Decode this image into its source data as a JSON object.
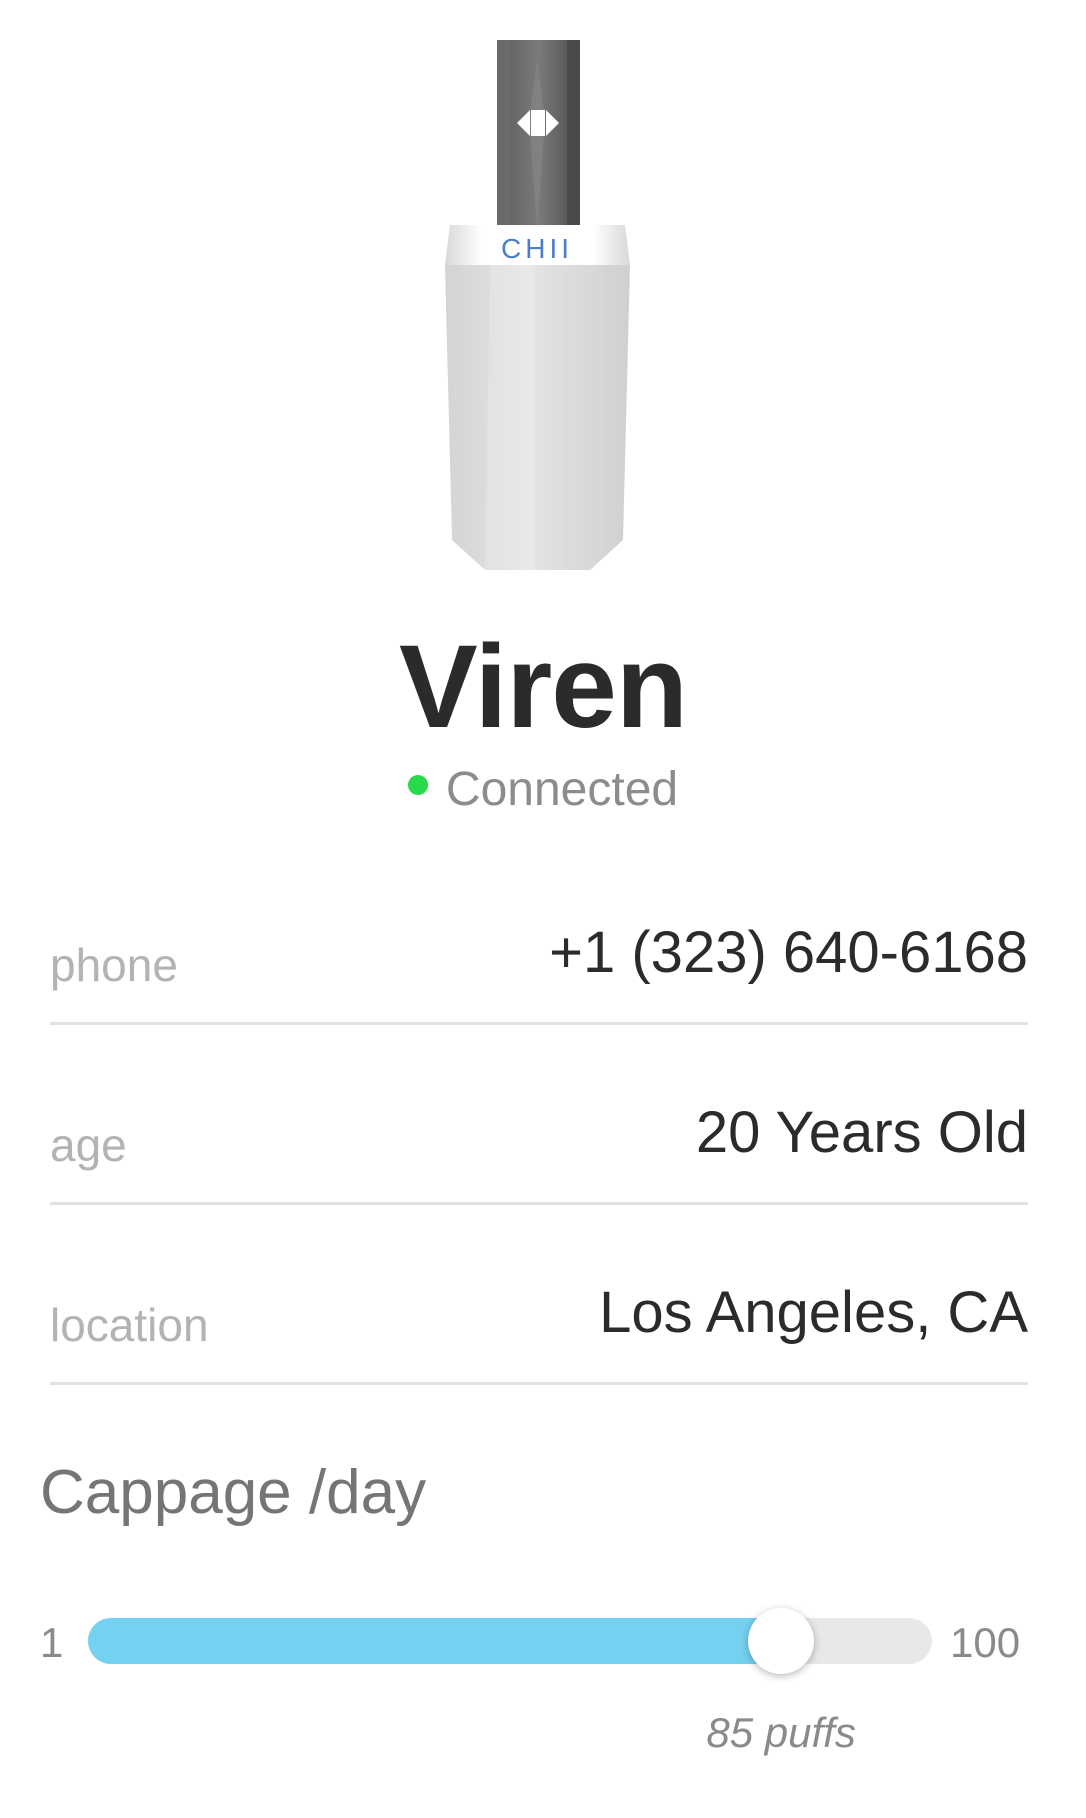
{
  "device": {
    "image_icon": "vape-pod-device-icon",
    "brand_mark": "CHII",
    "name": "Viren",
    "status": "Connected",
    "status_color": "#2ad94a"
  },
  "info": {
    "phone": {
      "label": "phone",
      "value": "+1 (323) 640-6168"
    },
    "age": {
      "label": "age",
      "value": "20 Years Old"
    },
    "location": {
      "label": "location",
      "value": "Los Angeles, CA"
    }
  },
  "cappage": {
    "title": "Cappage /day",
    "min_label": "1",
    "max_label": "100",
    "min": 1,
    "max": 100,
    "value": 85,
    "value_label": "85 puffs",
    "fill_color": "#74d1ef"
  }
}
